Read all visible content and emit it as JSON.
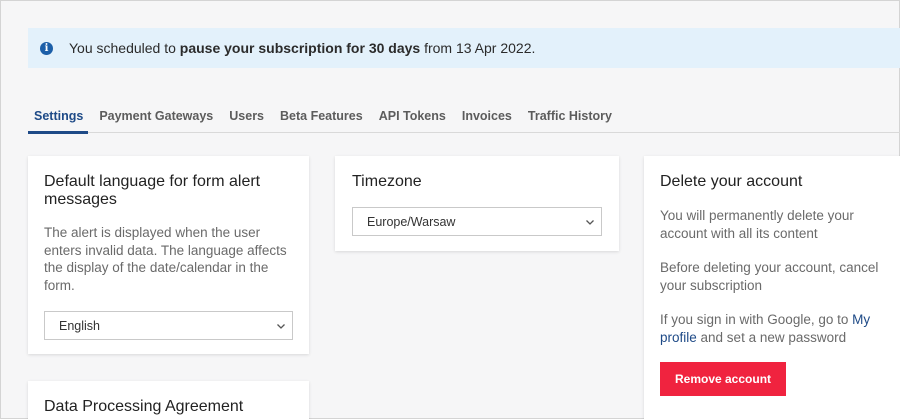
{
  "banner": {
    "icon": "info-icon",
    "prefix": "You scheduled to ",
    "bold": "pause your subscription for 30 days",
    "suffix": " from 13 Apr 2022."
  },
  "tabs": [
    {
      "label": "Settings",
      "active": true
    },
    {
      "label": "Payment Gateways"
    },
    {
      "label": "Users"
    },
    {
      "label": "Beta Features"
    },
    {
      "label": "API Tokens"
    },
    {
      "label": "Invoices"
    },
    {
      "label": "Traffic History"
    }
  ],
  "language_card": {
    "title": "Default language for form alert messages",
    "description": "The alert is displayed when the user enters invalid data. The language affects the display of the date/calendar in the form.",
    "selected": "English"
  },
  "timezone_card": {
    "title": "Timezone",
    "selected": "Europe/Warsaw"
  },
  "delete_card": {
    "title": "Delete your account",
    "text1": "You will permanently delete your account with all its content",
    "text2": "Before deleting your account, cancel your subscription",
    "text3_prefix": "If you sign in with Google, go to ",
    "text3_link": "My profile",
    "text3_suffix": " and set a new password",
    "button": "Remove account"
  },
  "dpa_card": {
    "title": "Data Processing Agreement"
  },
  "colors": {
    "accent": "#1e4a87",
    "banner_bg": "#e3f1fb",
    "danger": "#f0233f"
  }
}
